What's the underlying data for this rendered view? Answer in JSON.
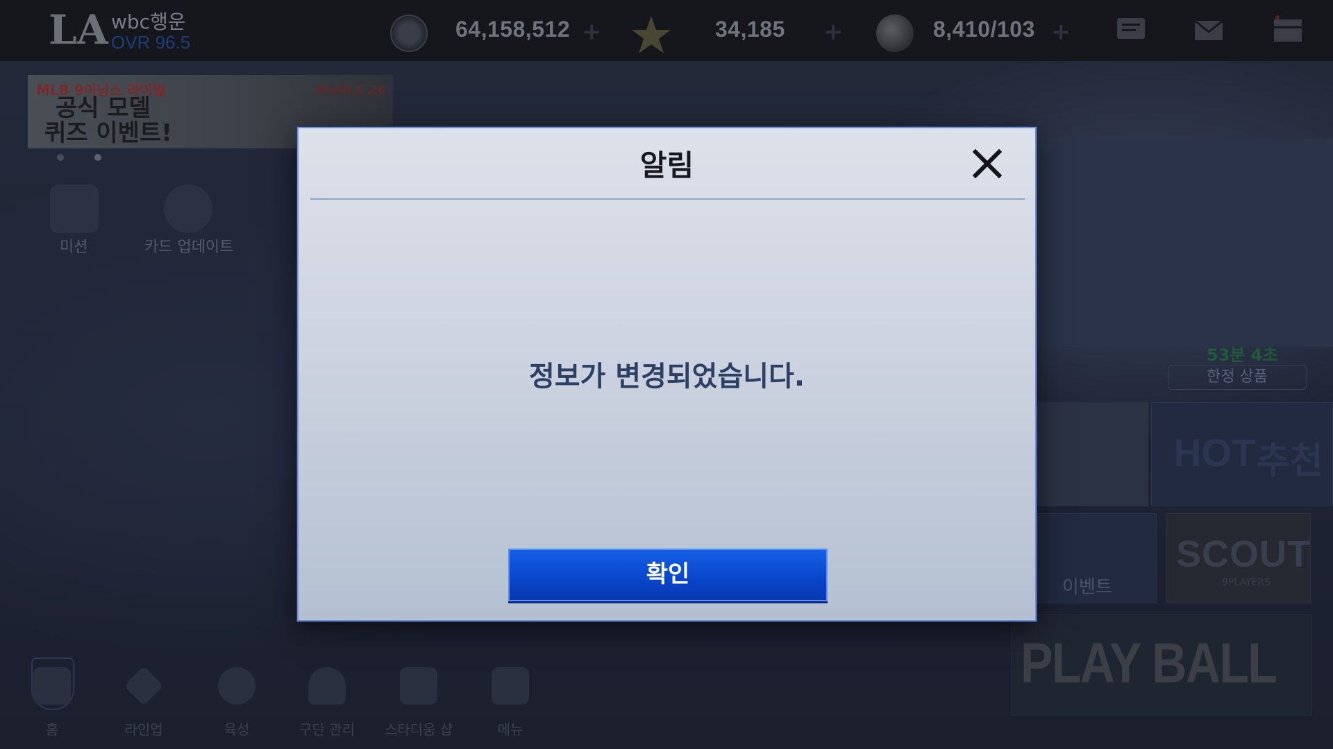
{
  "header": {
    "team_logo": "LA",
    "username": "wbc행운",
    "ovr": "OVR 96.5",
    "points": "64,158,512",
    "stars": "34,185",
    "balls": "8,410/103"
  },
  "banner": {
    "line1": "MLB 9이닝스 라이벌",
    "line2a": "공식 모델",
    "line2b": "퀴즈 이벤트!",
    "brand": "RIVALS 26"
  },
  "shortcuts": {
    "mission": "미션",
    "card_update": "카드 업데이트"
  },
  "right_panel": {
    "timer": "53분 4초",
    "limited_label": "한정 상품",
    "hot_label": "HOT",
    "recommend_label": "추천",
    "event_label": "이벤트",
    "scout_label": "SCOUT",
    "scout_sub": "9PLAYERS",
    "playball_label": "PLAY BALL"
  },
  "bottom_nav": {
    "items": [
      "홈",
      "라인업",
      "육성",
      "구단 관리",
      "스타디움 샵",
      "메뉴"
    ]
  },
  "modal": {
    "title": "알림",
    "message": "정보가 변경되었습니다.",
    "confirm_label": "확인"
  },
  "colors": {
    "confirm_button": "#0a47cd",
    "modal_border": "#6f8fd6",
    "message_text": "#2c3f64"
  }
}
